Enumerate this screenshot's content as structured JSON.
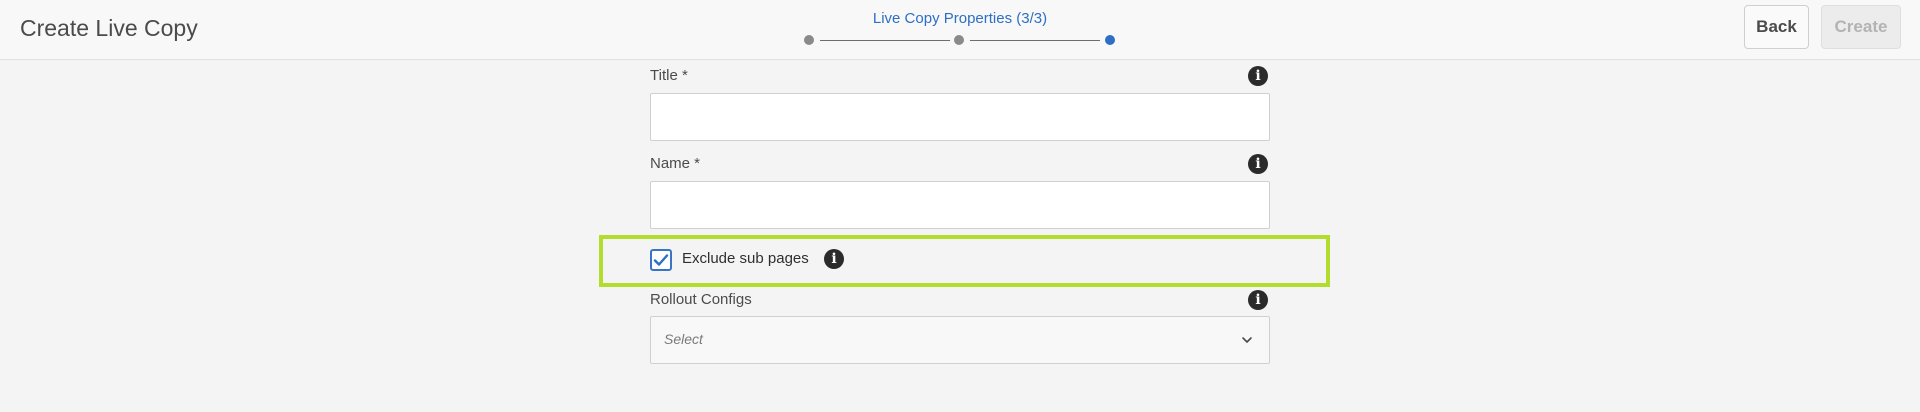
{
  "header": {
    "title": "Create Live Copy",
    "step_title": "Live Copy Properties (3/3)",
    "steps": [
      "step-1",
      "step-2",
      "step-3"
    ],
    "active_step": 3,
    "back_label": "Back",
    "create_label": "Create"
  },
  "form": {
    "title_label": "Title *",
    "title_value": "",
    "name_label": "Name *",
    "name_value": "",
    "exclude_label": "Exclude sub pages",
    "exclude_checked": true,
    "rollout_label": "Rollout Configs",
    "rollout_placeholder": "Select",
    "info_icon": "info-icon"
  },
  "colors": {
    "accent": "#2d6fc4",
    "highlight": "#b2dd2c",
    "background": "#f4f4f4"
  }
}
